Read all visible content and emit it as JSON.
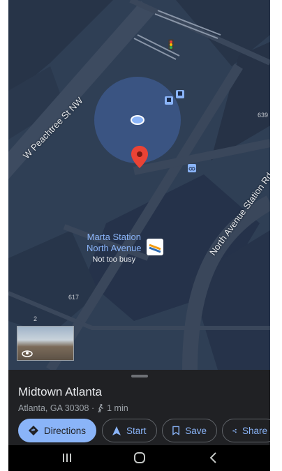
{
  "map": {
    "street_labels": {
      "peachtree": "W Peachtree St NW",
      "north_ave_station": "North Avenue Station Rd"
    },
    "station": {
      "name_line1": "Marta Station",
      "name_line2": "North Avenue",
      "busy": "Not too busy"
    },
    "numbers": {
      "n639": "639",
      "n617": "617",
      "n2": "2"
    },
    "icons": [
      "traffic-light-icon",
      "bus-stop-icon",
      "bike-icon",
      "location-pin-icon",
      "street-view-thumbnail"
    ]
  },
  "place": {
    "title": "Midtown Atlanta",
    "address": "Atlanta, GA 30308 ·",
    "walk_time": "1 min"
  },
  "actions": {
    "directions": "Directions",
    "start": "Start",
    "save": "Save",
    "share": "Share"
  },
  "colors": {
    "accent": "#8ab4f8",
    "pin": "#ea4335",
    "sheet_bg": "#202124",
    "map_bg": "#2f3f55"
  }
}
